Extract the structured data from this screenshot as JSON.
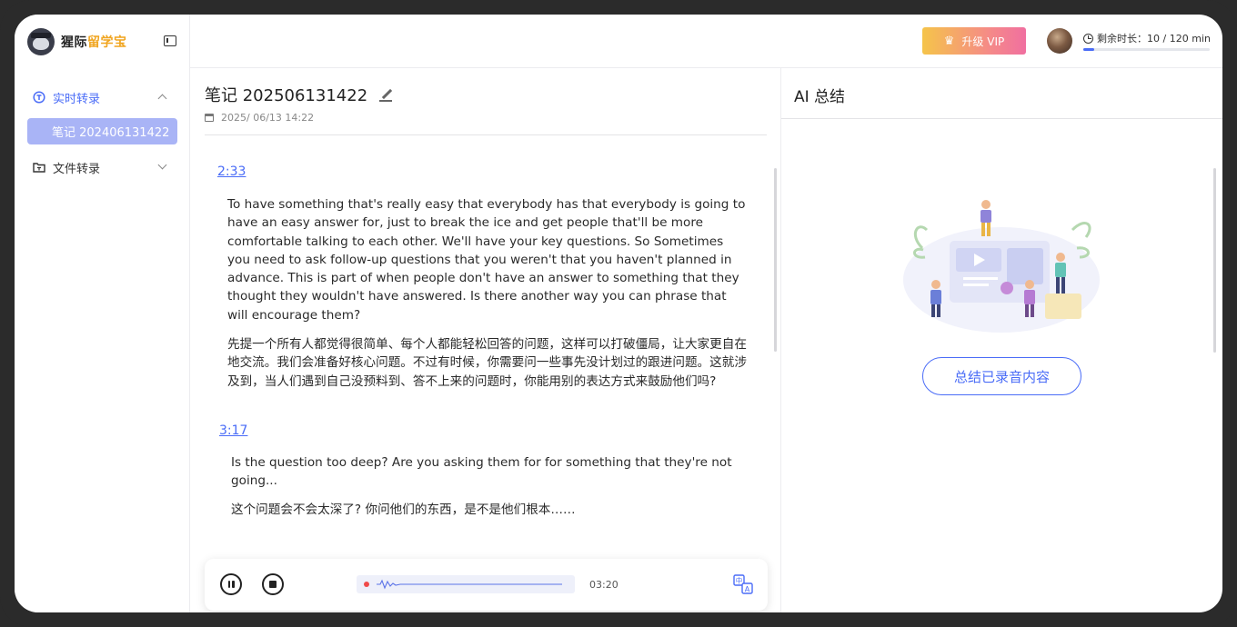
{
  "brand": {
    "name_part1": "猩际",
    "name_part2": "留学宝"
  },
  "sidebar": {
    "items": [
      {
        "label": "实时转录",
        "expanded": true
      },
      {
        "label": "文件转录",
        "expanded": false
      }
    ],
    "sub_items": [
      {
        "label": "笔记 202406131422"
      }
    ]
  },
  "topbar": {
    "vip_label": "升级 VIP",
    "remain_label": "剩余时长：",
    "remain_value": "10 / 120 min",
    "remain_fraction": 0.083
  },
  "note": {
    "title": "笔记 202506131422",
    "date": "2025/ 06/13   14:22",
    "segments": [
      {
        "time": "2:33",
        "en": "To have something that's really easy that everybody has that everybody is going to have an easy answer for, just to break the ice and get people that'll be more comfortable talking to each other. We'll have your key questions. So Sometimes you need to ask follow-up questions that you weren't that you haven't planned in advance. This is part of when people don't have an answer to something that they thought they wouldn't have answered. Is there another way you can phrase that will encourage them?",
        "zh": "先提一个所有人都觉得很简单、每个人都能轻松回答的问题，这样可以打破僵局，让大家更自在地交流。我们会准备好核心问题。不过有时候，你需要问一些事先没计划过的跟进问题。这就涉及到，当人们遇到自己没预料到、答不上来的问题时，你能用别的表达方式来鼓励他们吗?"
      },
      {
        "time": "3:17",
        "en": "Is the question too deep? Are you asking them for for something that they're not going...",
        "zh": "这个问题会不会太深了? 你问他们的东西，是不是他们根本……"
      }
    ]
  },
  "player": {
    "time": "03:20"
  },
  "ai": {
    "title": "AI 总结",
    "button_label": "总结已录音内容"
  },
  "colors": {
    "accent": "#4a6cf7",
    "active_bg": "#a9b4f6",
    "rec": "#f04a4a"
  }
}
